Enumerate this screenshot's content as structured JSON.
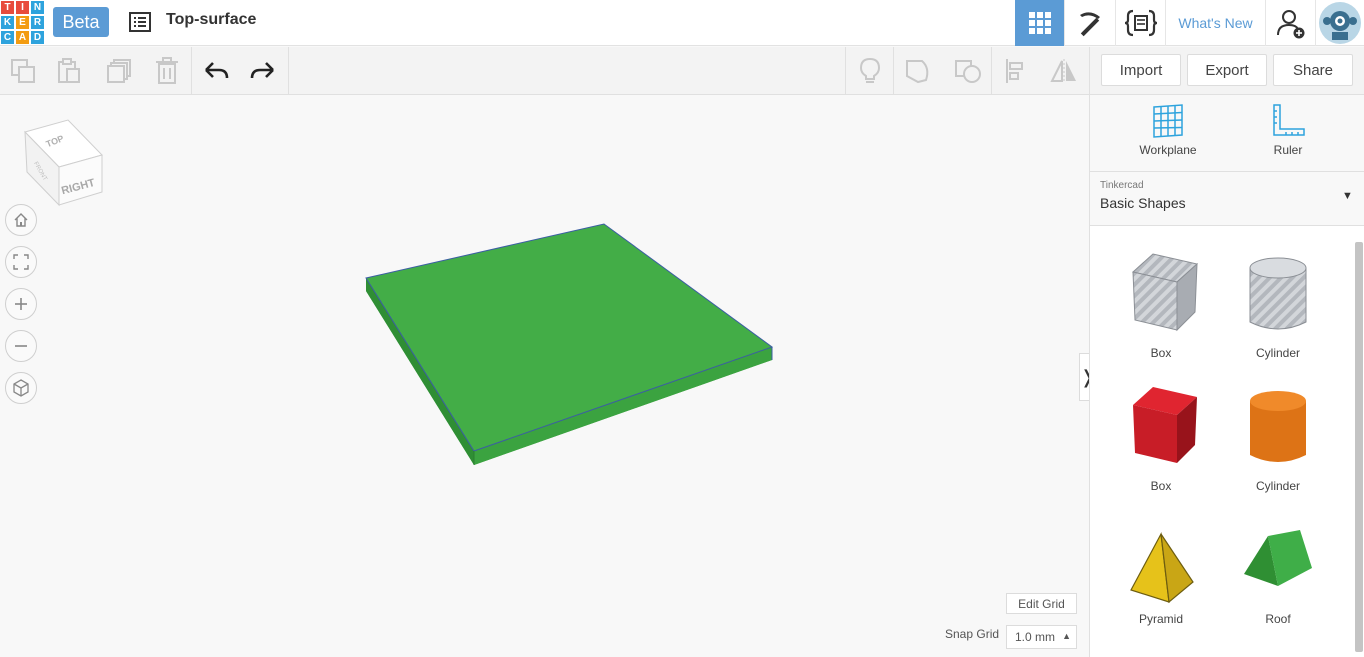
{
  "header": {
    "logo_letters": [
      "T",
      "I",
      "N",
      "K",
      "E",
      "R",
      "C",
      "A",
      "D"
    ],
    "logo_colors": [
      "#e84c3d",
      "#e84c3d",
      "#2ea3dd",
      "#2ea3dd",
      "#f39c12",
      "#2ea3dd",
      "#2ea3dd",
      "#f39c12",
      "#2ea3dd"
    ],
    "beta_label": "Beta",
    "design_title": "Top-surface",
    "whats_new": "What's New"
  },
  "toolbar": {
    "import_label": "Import",
    "export_label": "Export",
    "share_label": "Share"
  },
  "panel": {
    "workplane_label": "Workplane",
    "ruler_label": "Ruler",
    "library_source": "Tinkercad",
    "library_name": "Basic Shapes",
    "shapes": [
      {
        "label": "Box",
        "color": "#cfd2d6"
      },
      {
        "label": "Cylinder",
        "color": "#cfd2d6"
      },
      {
        "label": "Box",
        "color": "#d01f2b"
      },
      {
        "label": "Cylinder",
        "color": "#e67e22"
      },
      {
        "label": "Pyramid",
        "color": "#f1c40f"
      },
      {
        "label": "Roof",
        "color": "#3fae48"
      }
    ]
  },
  "viewcube": {
    "top_label": "TOP",
    "right_label": "RIGHT",
    "front_label": "FRONT"
  },
  "canvas": {
    "edit_grid_label": "Edit Grid",
    "snap_grid_label": "Snap Grid",
    "snap_grid_value": "1.0 mm",
    "shape_color": "#43ad47"
  }
}
